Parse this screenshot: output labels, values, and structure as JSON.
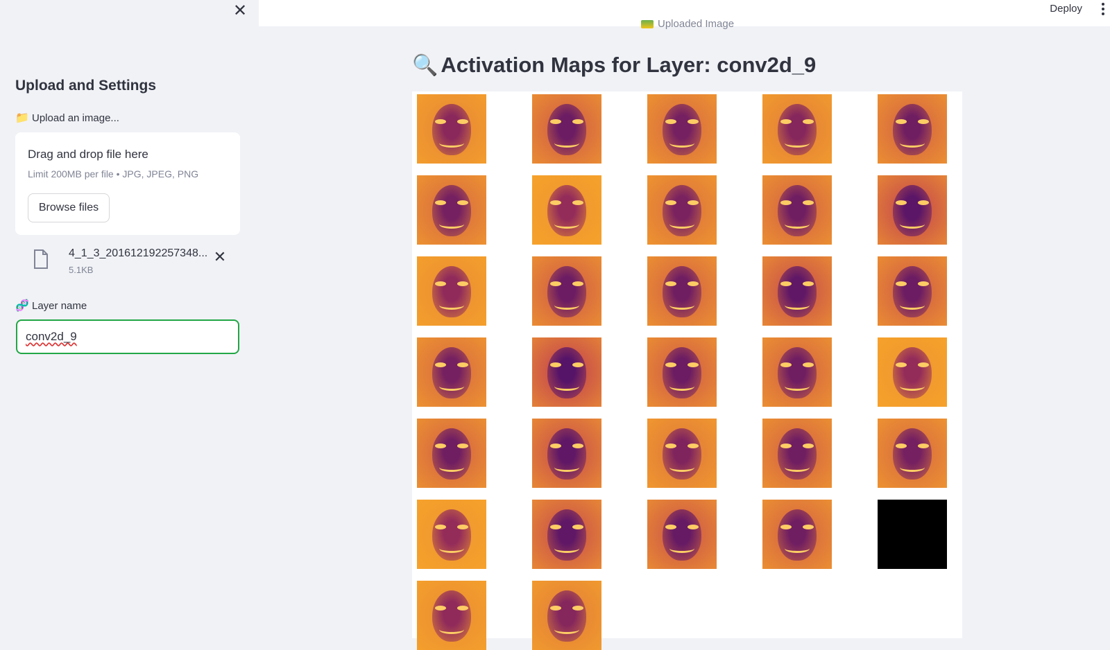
{
  "sidebar": {
    "close_icon": "close-icon",
    "heading": "Upload and Settings",
    "upload_label": "Upload an image...",
    "upload_icon": "folder-icon",
    "dropzone": {
      "title": "Drag and drop file here",
      "subtitle": "Limit 200MB per file • JPG, JPEG, PNG",
      "browse_label": "Browse files"
    },
    "file": {
      "name": "4_1_3_201612192257348...",
      "size": "5.1KB"
    },
    "layer_label": "Layer name",
    "layer_icon": "dna-icon",
    "layer_value": "conv2d_9"
  },
  "header": {
    "deploy_label": "Deploy",
    "menu_icon": "more-vertical-icon"
  },
  "main": {
    "caption": "Uploaded Image",
    "title": "Activation Maps for Layer: conv2d_9",
    "title_icon": "magnifier-icon",
    "maps_count": 32,
    "colormap": "inferno"
  }
}
